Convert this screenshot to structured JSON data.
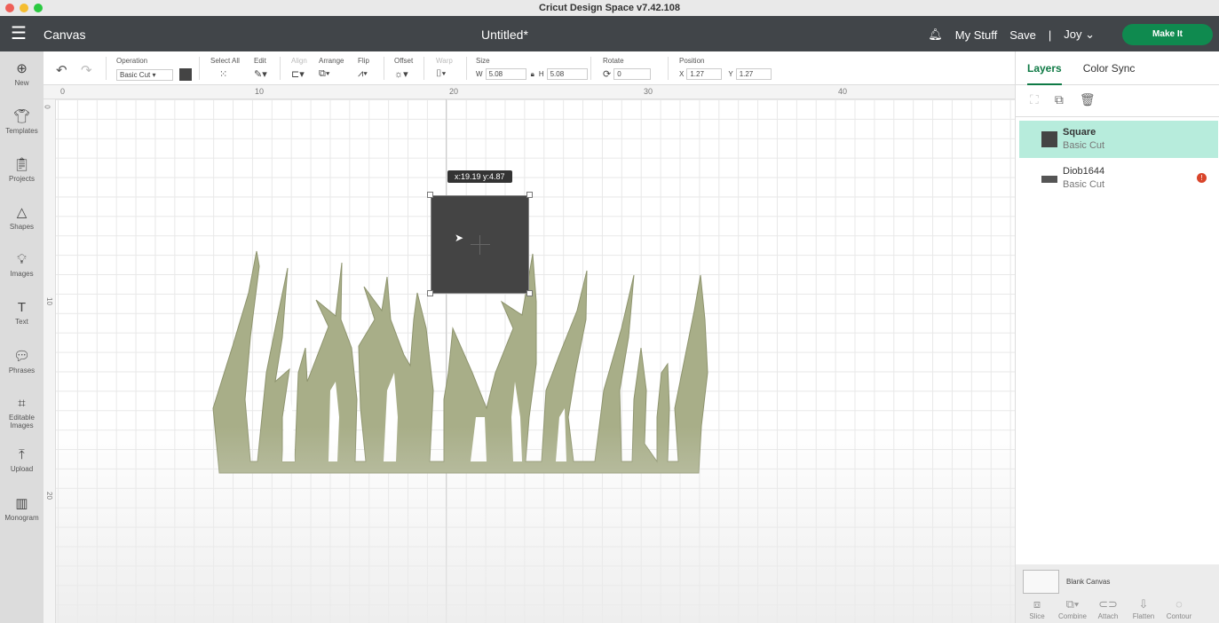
{
  "app_title": "Cricut Design Space  v7.42.108",
  "header": {
    "canvas": "Canvas",
    "doc_title": "Untitled*",
    "my_stuff": "My Stuff",
    "save": "Save",
    "divider": "|",
    "user": "Joy",
    "make_it": "Make It"
  },
  "sidebar": [
    {
      "label": "New",
      "icon": "plus-circle"
    },
    {
      "label": "Templates",
      "icon": "shirt"
    },
    {
      "label": "Projects",
      "icon": "clipboard"
    },
    {
      "label": "Shapes",
      "icon": "shapes"
    },
    {
      "label": "Images",
      "icon": "bulb"
    },
    {
      "label": "Text",
      "icon": "T"
    },
    {
      "label": "Phrases",
      "icon": "speech"
    },
    {
      "label": "Editable Images",
      "icon": "vector"
    },
    {
      "label": "Upload",
      "icon": "upload"
    },
    {
      "label": "Monogram",
      "icon": "monogram"
    }
  ],
  "toolbar": {
    "operation_label": "Operation",
    "operation_value": "Basic Cut",
    "operation_color": "#444444",
    "select_all": "Select All",
    "edit": "Edit",
    "align": "Align",
    "arrange": "Arrange",
    "flip": "Flip",
    "offset": "Offset",
    "warp": "Warp",
    "size": "Size",
    "w_label": "W",
    "w": "5.08",
    "h_label": "H",
    "h": "5.08",
    "rotate": "Rotate",
    "rotate_value": "0",
    "position": "Position",
    "x_label": "X",
    "x": "1.27",
    "y_label": "Y",
    "y": "1.27"
  },
  "ruler": {
    "h": [
      "0",
      "10",
      "20",
      "30",
      "40"
    ],
    "v": [
      "0",
      "10",
      "20"
    ]
  },
  "canvas": {
    "tooltip": "x:19.19 y:4.87",
    "square_color": "#444444",
    "grass_color": "#a8ae88"
  },
  "panel": {
    "tabs": [
      "Layers",
      "Color Sync"
    ],
    "layers": [
      {
        "name": "Square",
        "op": "Basic Cut"
      },
      {
        "name": "Diob1644",
        "op": "Basic Cut"
      }
    ],
    "blank_canvas": "Blank Canvas",
    "bottom_tools": [
      "Slice",
      "Combine",
      "Attach",
      "Flatten",
      "Contour"
    ]
  }
}
